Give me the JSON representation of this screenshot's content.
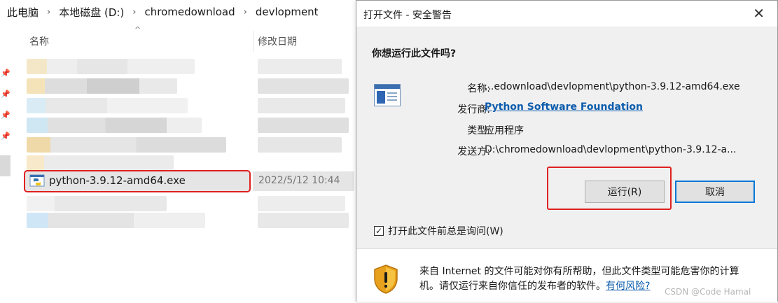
{
  "explorer": {
    "breadcrumb": [
      "此电脑",
      "本地磁盘 (D:)",
      "chromedownload",
      "devlopment"
    ],
    "columns": {
      "name": "名称",
      "date": "修改日期"
    },
    "selected_file": {
      "name": "python-3.9.12-amd64.exe",
      "date": "2022/5/12 10:44"
    }
  },
  "dialog": {
    "title": "打开文件 - 安全警告",
    "close_glyph": "✕",
    "question": "你想运行此文件吗?",
    "fields": {
      "name_label": "名称:",
      "name_value": "...edownload\\devlopment\\python-3.9.12-amd64.exe",
      "publisher_label": "发行商:",
      "publisher_value": "Python Software Foundation",
      "type_label": "类型:",
      "type_value": "应用程序",
      "from_label": "发送方:",
      "from_value": "D:\\chromedownload\\devlopment\\python-3.9.12-a..."
    },
    "buttons": {
      "run": "运行(R)",
      "cancel": "取消"
    },
    "checkbox": {
      "label": "打开此文件前总是询问(W)",
      "checked": true,
      "mark": "✓"
    },
    "warning": {
      "text": "来自 Internet 的文件可能对你有所帮助，但此文件类型可能危害你的计算机。请仅运行来自你信任的发布者的软件。",
      "link": "有何风险?"
    }
  },
  "watermark": "CSDN @Code Hamal",
  "colors": {
    "highlight_red": "#e02020",
    "link_blue": "#0b5cad",
    "focus_blue": "#0078d7",
    "dialog_bg": "#f0f0f0"
  },
  "icons": [
    "pin-icon",
    "python-file-icon",
    "application-icon",
    "warning-shield-icon",
    "close-icon",
    "checkmark-icon"
  ]
}
